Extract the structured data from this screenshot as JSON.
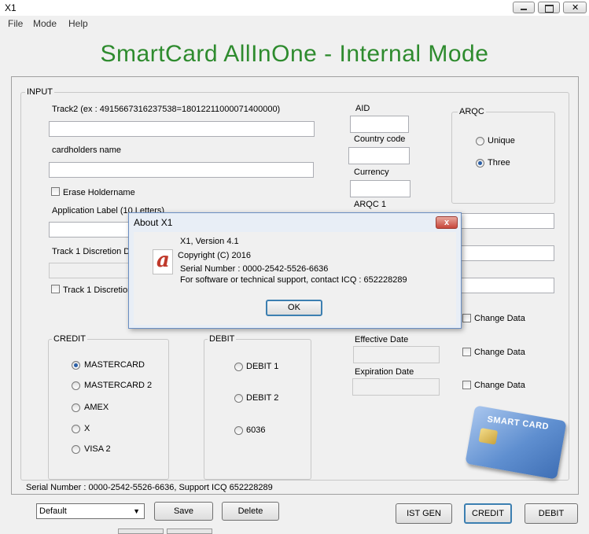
{
  "window": {
    "title": "X1"
  },
  "menu": [
    "File",
    "Mode",
    "Help"
  ],
  "heading": "SmartCard AllInOne - Internal Mode",
  "input_group": {
    "label": "INPUT",
    "track2_label": "Track2 (ex : 4915667316237538=18012211000071400000)",
    "cardholder_label": "cardholders name",
    "erase_holdername": "Erase Holdername",
    "app_label": "Application Label (10 Letters)",
    "track1_disc_label": "Track 1 Discretion Da",
    "track1_disc_check": "Track 1 Discretion"
  },
  "right_fields": {
    "aid": "AID",
    "country_code": "Country code",
    "currency": "Currency",
    "arqc1": "ARQC 1",
    "effective_date": "Effective Date",
    "expiration_date": "Expiration Date",
    "change_data": "Change Data"
  },
  "arqc": {
    "label": "ARQC",
    "options": [
      "Unique",
      "Three"
    ],
    "selected": "Three"
  },
  "credit": {
    "label": "CREDIT",
    "options": [
      "MASTERCARD",
      "MASTERCARD 2",
      "AMEX",
      "X",
      "VISA 2"
    ],
    "selected": "MASTERCARD"
  },
  "debit": {
    "label": "DEBIT",
    "options": [
      "DEBIT 1",
      "DEBIT 2",
      "6036"
    ]
  },
  "serial_line": "Serial Number : 0000-2542-5526-6636, Support ICQ 652228289",
  "bottom": {
    "profile_select": "Default",
    "save": "Save",
    "delete": "Delete",
    "ist_gen": "IST GEN",
    "credit": "CREDIT",
    "debit": "DEBIT"
  },
  "card_image": {
    "text": "SMART CARD"
  },
  "about": {
    "title": "About X1",
    "close": "x",
    "version": "X1, Version 4.1",
    "copyright": "Copyright (C) 2016",
    "serial": "Serial Number : 0000-2542-5526-6636",
    "support": "For software or technical support, contact ICQ : 652228289",
    "ok": "OK",
    "icon_letter": "a"
  }
}
